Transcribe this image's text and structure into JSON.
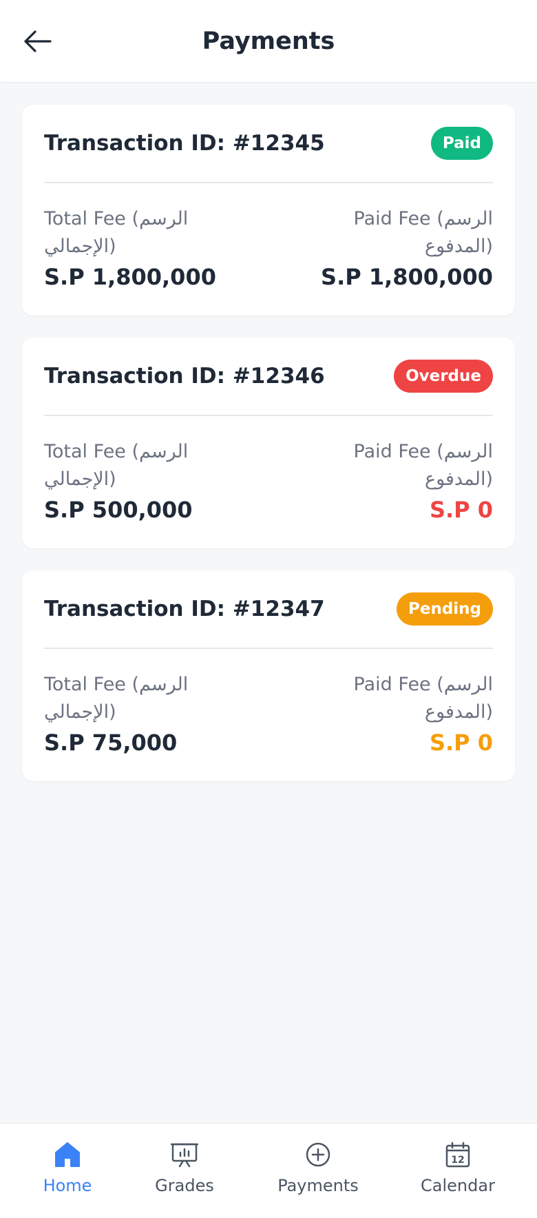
{
  "header": {
    "title": "Payments",
    "back_icon": "arrow-left-icon"
  },
  "transactions": [
    {
      "id_label": "Transaction ID: #12345",
      "status": "Paid",
      "status_color": "#10b981",
      "total_label": "Total Fee (الرسم الإجمالي)",
      "total_amount": "S.P 1,800,000",
      "paid_label": "Paid Fee (الرسم المدفوع)",
      "paid_amount": "S.P 1,800,000",
      "paid_color": "#1f2937"
    },
    {
      "id_label": "Transaction ID: #12346",
      "status": "Overdue",
      "status_color": "#ef4444",
      "total_label": "Total Fee (الرسم الإجمالي)",
      "total_amount": "S.P 500,000",
      "paid_label": "Paid Fee (الرسم المدفوع)",
      "paid_amount": "S.P 0",
      "paid_color": "#ef4444"
    },
    {
      "id_label": "Transaction ID: #12347",
      "status": "Pending",
      "status_color": "#f59e0b",
      "total_label": "Total Fee (الرسم الإجمالي)",
      "total_amount": "S.P 75,000",
      "paid_label": "Paid Fee (الرسم المدفوع)",
      "paid_amount": "S.P 0",
      "paid_color": "#f59e0b"
    }
  ],
  "bottom_nav": {
    "active_color": "#3b82f6",
    "inactive_color": "#4b5563",
    "items": [
      {
        "label": "Home",
        "icon": "home-icon",
        "active": true
      },
      {
        "label": "Grades",
        "icon": "presentation-chart-icon",
        "active": false
      },
      {
        "label": "Payments",
        "icon": "plus-circle-icon",
        "active": false
      },
      {
        "label": "Calendar",
        "icon": "calendar-icon",
        "active": false,
        "icon_text": "12"
      }
    ]
  }
}
